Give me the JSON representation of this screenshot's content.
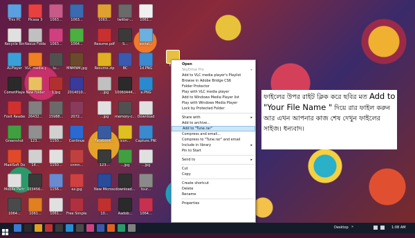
{
  "desktop": {
    "icons": [
      {
        "label": "This PC",
        "color": "#5aa0e0"
      },
      {
        "label": "Picasa 3",
        "color": "#e84040"
      },
      {
        "label": "1063...",
        "color": "#c85a8a"
      },
      {
        "label": "1063...",
        "color": "#3a6ab0"
      },
      {
        "label": "1063...",
        "color": "#e0a030"
      },
      {
        "label": "twitter-...",
        "color": "#6a6a6a"
      },
      {
        "label": "1061...",
        "color": "#f0f0f0"
      },
      {
        "label": "Recycle Bin",
        "color": "#e0e0e0"
      },
      {
        "label": "Nexus Folder",
        "color": "#c0c0c0"
      },
      {
        "label": "1063...",
        "color": "#d04080"
      },
      {
        "label": "1064...",
        "color": "#4ab040"
      },
      {
        "label": "Resume.pdf",
        "color": "#c83030"
      },
      {
        "label": "S...",
        "color": "#3a3a3a"
      },
      {
        "label": "social...",
        "color": "#6ab0e0"
      },
      {
        "label": "ALPlayer",
        "color": "#3aa0d8"
      },
      {
        "label": "VLC media player",
        "color": "#f08020"
      },
      {
        "label": "lu...",
        "color": "#505050"
      },
      {
        "label": "MNMNM.jpg",
        "color": "#6a4a2a"
      },
      {
        "label": "Resume.zip",
        "color": "#e0b020"
      },
      {
        "label": "BC",
        "color": "#3a5ab0"
      },
      {
        "label": "1d.PNG",
        "color": "#3a8ad0"
      },
      {
        "label": "CometPlayer",
        "color": "#2a2a2a"
      },
      {
        "label": "New folder",
        "color": "#e8c060"
      },
      {
        "label": "1.jpg",
        "color": "#b03030"
      },
      {
        "label": "2014010...",
        "color": "#3a3a9a"
      },
      {
        "label": "...jpg",
        "color": "#c0c0c0"
      },
      {
        "label": "10060444...",
        "color": "#2a2a2a"
      },
      {
        "label": "e.PNG",
        "color": "#2a8ad0"
      },
      {
        "label": "Foxit Reader",
        "color": "#d03030"
      },
      {
        "label": "26432...",
        "color": "#808080"
      },
      {
        "label": "15988...",
        "color": "#6a6a6a"
      },
      {
        "label": "2072...",
        "color": "#8a3a5a"
      },
      {
        "label": "...jpg",
        "color": "#e0e0e0"
      },
      {
        "label": "memory-c...",
        "color": "#505050"
      },
      {
        "label": "Download",
        "color": "#e0e0e0"
      },
      {
        "label": "Greenshot",
        "color": "#40a040"
      },
      {
        "label": "123...",
        "color": "#909090"
      },
      {
        "label": "1150...",
        "color": "#d0d0d0"
      },
      {
        "label": "Continue",
        "color": "#2a6ad0"
      },
      {
        "label": "Facebook...",
        "color": "#3a5aa0"
      },
      {
        "label": "icon...",
        "color": "#e0c020"
      },
      {
        "label": "Capture.PNG",
        "color": "#3a8ad0"
      },
      {
        "label": "MadiSoft Downloa...",
        "color": "#e04a2a"
      },
      {
        "label": "14...",
        "color": "#d0d0d0"
      },
      {
        "label": "1150...",
        "color": "#e0e0e0"
      },
      {
        "label": "cnmn...",
        "color": "#c04040"
      },
      {
        "label": "123...",
        "color": "#3a3a3a"
      },
      {
        "label": "...jpg",
        "color": "#40a040"
      },
      {
        "label": "...jpg",
        "color": "#e0e0e0"
      },
      {
        "label": "Mobile Partner",
        "color": "#e0e0e0"
      },
      {
        "label": "123456...",
        "color": "#3a3a3a"
      },
      {
        "label": "1156...",
        "color": "#6a8ad0"
      },
      {
        "label": "ex.jpg",
        "color": "#d04040"
      },
      {
        "label": "New Microsoft...",
        "color": "#2a4a9a"
      },
      {
        "label": "download...",
        "color": "#303030"
      },
      {
        "label": "tour...",
        "color": "#8a8a8a"
      },
      {
        "label": "1064...",
        "color": "#4a4a4a"
      },
      {
        "label": "1061...",
        "color": "#e08020"
      },
      {
        "label": "1061...",
        "color": "#e0e0e0"
      },
      {
        "label": "Free Simple...",
        "color": "#b03040"
      },
      {
        "label": "10...",
        "color": "#c03030"
      },
      {
        "label": "Aadob...",
        "color": "#2a2a2a"
      },
      {
        "label": "1064...",
        "color": "#c83050"
      }
    ]
  },
  "selected_file": {
    "label": "Tune",
    "color": "#e8c040"
  },
  "context_menu": {
    "items": [
      {
        "label": "Open",
        "bold": true
      },
      {
        "label": "SkyDrive Pro",
        "disabled": true,
        "arrow": true
      },
      {
        "label": "Add to VLC media player's Playlist"
      },
      {
        "label": "Browse in Adobe Bridge CS6"
      },
      {
        "label": "Folder Protector"
      },
      {
        "label": "Play with VLC media player"
      },
      {
        "label": "Add to Windows Media Player list"
      },
      {
        "label": "Play with Windows Media Player"
      },
      {
        "label": "Lock by Protected Folder"
      },
      {
        "separator": true
      },
      {
        "label": "Share with",
        "arrow": true
      },
      {
        "label": "Add to archive..."
      },
      {
        "label": "Add to \"Tune.rar\"",
        "highlight": true
      },
      {
        "label": "Compress and email..."
      },
      {
        "label": "Compress to \"Tune.rar\" and email"
      },
      {
        "label": "Include in library",
        "arrow": true
      },
      {
        "label": "Pin to Start"
      },
      {
        "separator": true
      },
      {
        "label": "Send to",
        "arrow": true
      },
      {
        "separator": true
      },
      {
        "label": "Cut"
      },
      {
        "label": "Copy"
      },
      {
        "separator": true
      },
      {
        "label": "Create shortcut"
      },
      {
        "label": "Delete"
      },
      {
        "label": "Rename"
      },
      {
        "separator": true
      },
      {
        "label": "Properties"
      }
    ]
  },
  "annotation": {
    "part1": "ফাইলের উপর রাইট ক্লিক করে ছবির মত ",
    "emph1": "Add to \"Your File Name \"",
    "part2": " দিয়ে রার ফাইল করুন আর এখন আপনার কাজ শেষ দেখুন ফাইলের সাইজ। ধন্যবাদ।"
  },
  "taskbar": {
    "desktop_label": "Desktop",
    "time": "1:08 AM",
    "apps": [
      "#3a7ad0",
      "#2a2a2a",
      "#e0a020",
      "#c03030",
      "#3a3a3a",
      "#2a8ad0",
      "#4a4a4a",
      "#d04080",
      "#3a5ab0",
      "#e06020",
      "#2a9a6a",
      "#808080"
    ]
  }
}
